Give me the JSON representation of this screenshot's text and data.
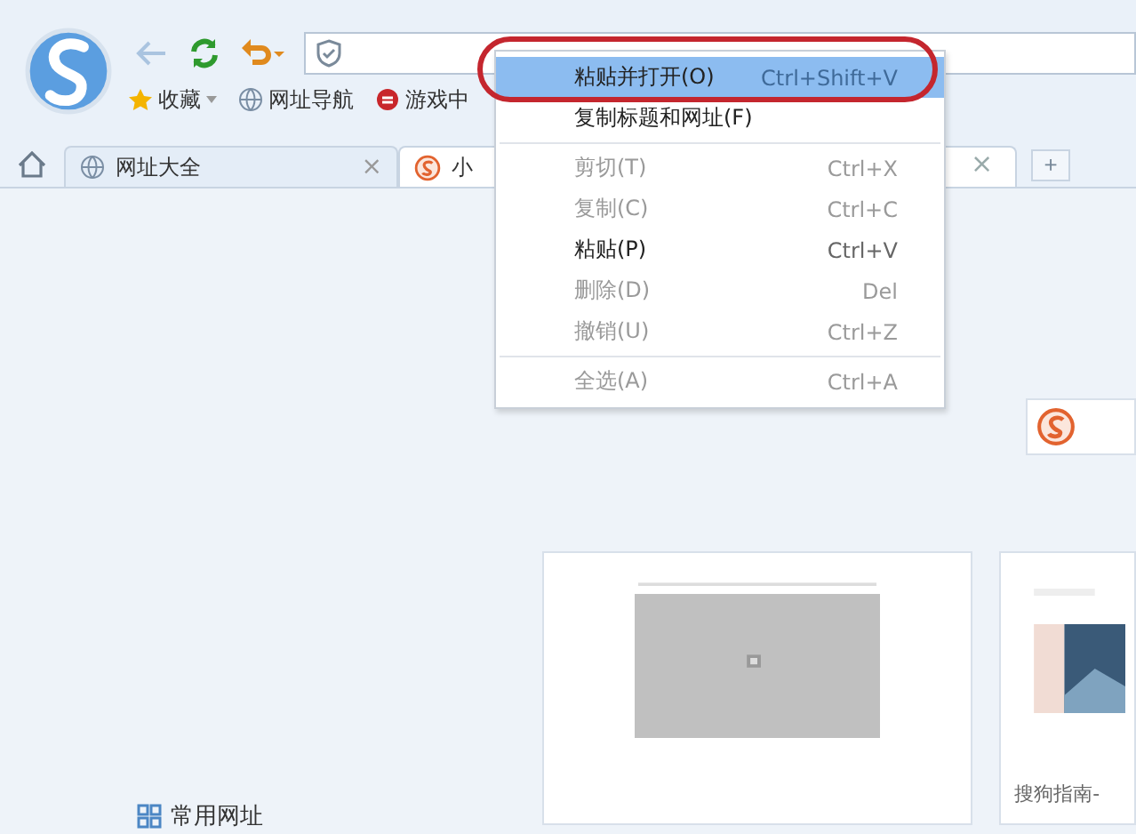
{
  "bookmarks": [
    {
      "label": "收藏"
    },
    {
      "label": "网址导航"
    },
    {
      "label": "游戏中"
    }
  ],
  "tabs": [
    {
      "label": "网址大全",
      "selected": false,
      "close": "×"
    },
    {
      "label": "小",
      "selected": true
    }
  ],
  "active_tab_close": "×",
  "new_tab": "+",
  "context_menu": [
    {
      "kind": "item",
      "label": "粘贴并打开(O)",
      "shortcut": "Ctrl+Shift+V",
      "disabled": false,
      "selected": true
    },
    {
      "kind": "item",
      "label": "复制标题和网址(F)",
      "disabled": false,
      "selected": false
    },
    {
      "kind": "separator"
    },
    {
      "kind": "item",
      "label": "剪切(T)",
      "shortcut": "Ctrl+X",
      "disabled": true,
      "selected": false
    },
    {
      "kind": "item",
      "label": "复制(C)",
      "shortcut": "Ctrl+C",
      "disabled": true,
      "selected": false
    },
    {
      "kind": "item",
      "label": "粘贴(P)",
      "shortcut": "Ctrl+V",
      "disabled": false,
      "selected": false
    },
    {
      "kind": "item",
      "label": "删除(D)",
      "shortcut": "Del",
      "disabled": true,
      "selected": false
    },
    {
      "kind": "item",
      "label": "撤销(U)",
      "shortcut": "Ctrl+Z",
      "disabled": true,
      "selected": false
    },
    {
      "kind": "separator"
    },
    {
      "kind": "item",
      "label": "全选(A)",
      "shortcut": "Ctrl+A",
      "disabled": true,
      "selected": false
    }
  ],
  "thumbnails": [
    {
      "kind": "picture"
    },
    {
      "kind": "picture",
      "caption": "搜狗指南-"
    }
  ],
  "frequent_sites": {
    "label": "常用网址"
  }
}
